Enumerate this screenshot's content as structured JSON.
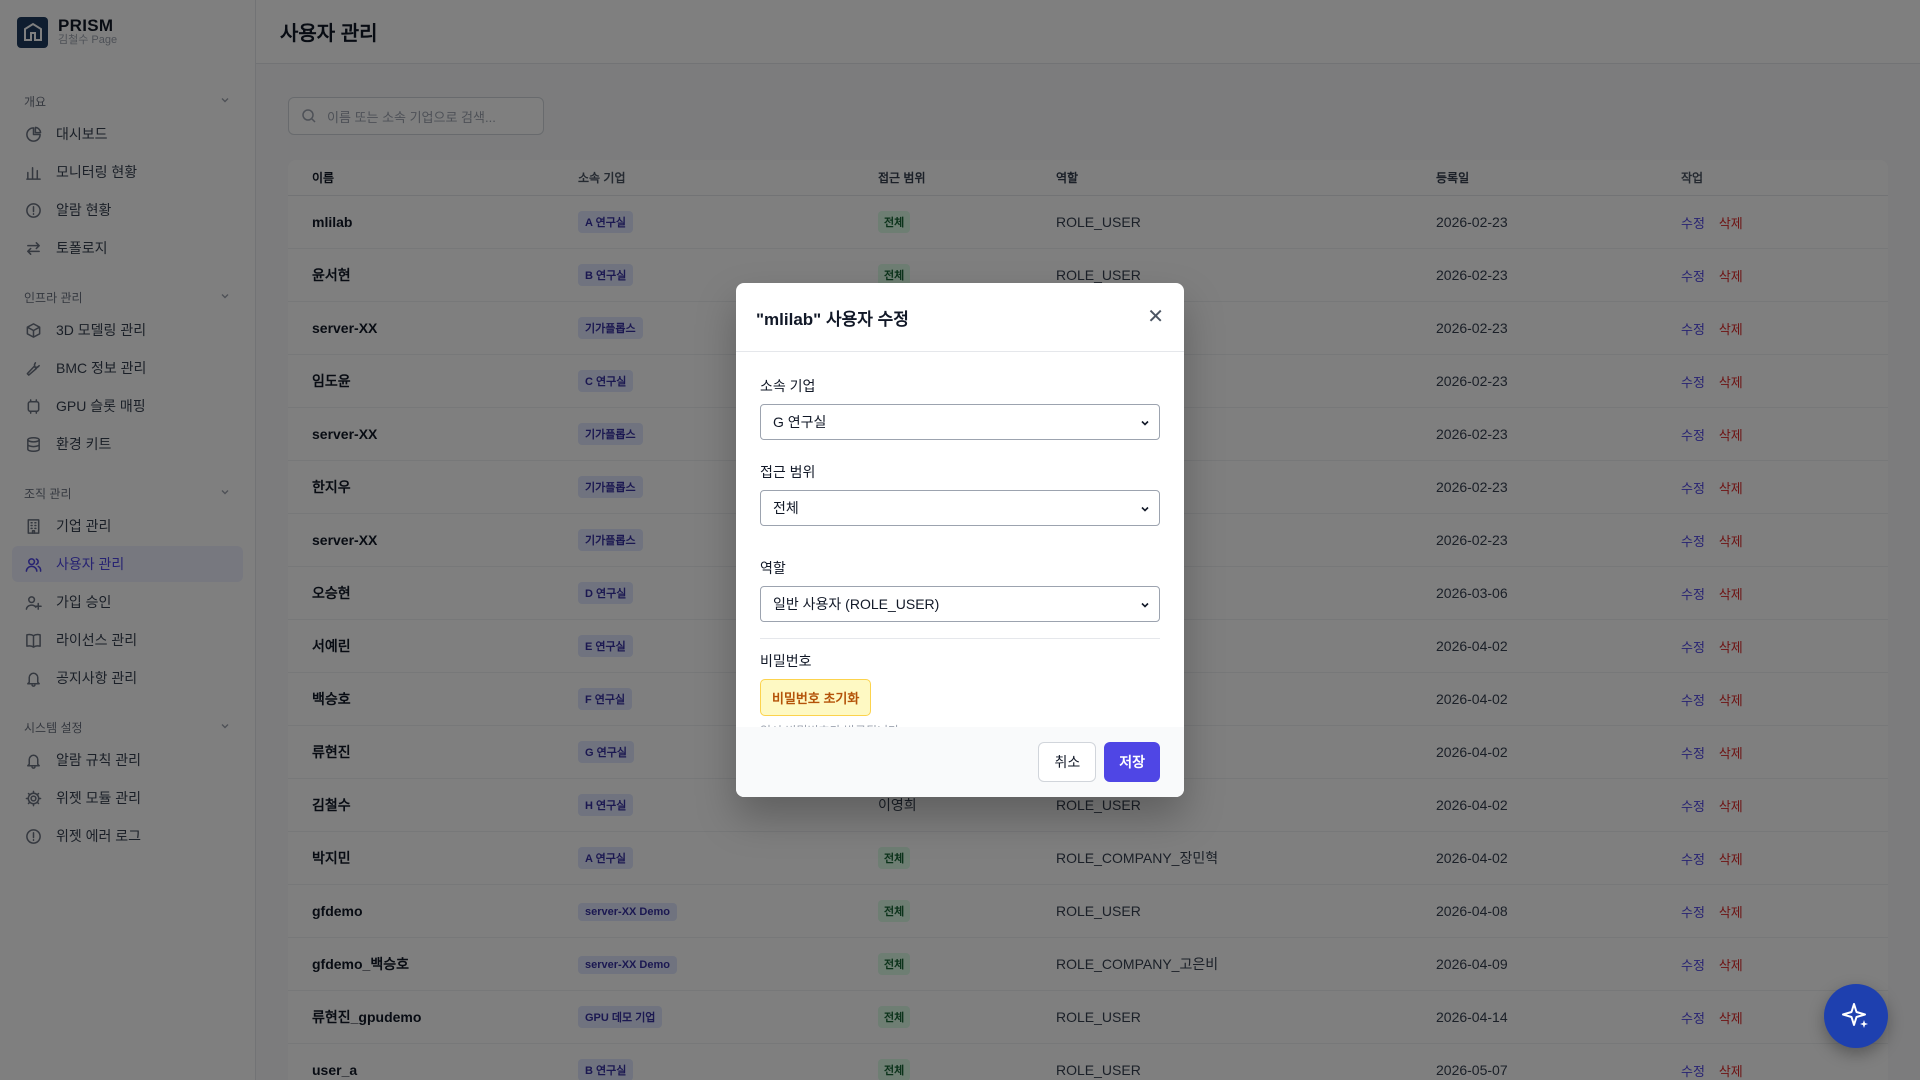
{
  "brand": {
    "name": "PRISM",
    "sub": "김철수 Page"
  },
  "sidebar": {
    "sections": [
      {
        "title": "개요",
        "items": [
          {
            "label": "대시보드",
            "icon": "pie-chart-icon"
          },
          {
            "label": "모니터링 현황",
            "icon": "bar-chart-icon"
          },
          {
            "label": "알람 현황",
            "icon": "alert-circle-icon"
          },
          {
            "label": "토폴로지",
            "icon": "arrows-swap-icon"
          }
        ]
      },
      {
        "title": "인프라 관리",
        "items": [
          {
            "label": "3D 모델링 관리",
            "icon": "cube-icon"
          },
          {
            "label": "BMC 정보 관리",
            "icon": "wrench-icon"
          },
          {
            "label": "GPU 슬롯 매핑",
            "icon": "chip-icon"
          },
          {
            "label": "환경 키트",
            "icon": "database-icon"
          }
        ]
      },
      {
        "title": "조직 관리",
        "items": [
          {
            "label": "기업 관리",
            "icon": "building-icon"
          },
          {
            "label": "사용자 관리",
            "icon": "users-icon",
            "active": true
          },
          {
            "label": "가입 승인",
            "icon": "user-plus-icon"
          },
          {
            "label": "라이선스 관리",
            "icon": "book-icon"
          },
          {
            "label": "공지사항 관리",
            "icon": "bell-icon"
          }
        ]
      },
      {
        "title": "시스템 설정",
        "items": [
          {
            "label": "알람 규칙 관리",
            "icon": "bell-icon"
          },
          {
            "label": "위젯 모듈 관리",
            "icon": "gear-icon"
          },
          {
            "label": "위젯 에러 로그",
            "icon": "alert-circle-icon"
          }
        ]
      }
    ]
  },
  "header": {
    "title": "사용자 관리"
  },
  "search": {
    "placeholder": "이름 또는 소속 기업으로 검색..."
  },
  "table": {
    "columns": [
      "이름",
      "소속 기업",
      "접근 범위",
      "역할",
      "등록일",
      "작업"
    ],
    "edit_label": "수정",
    "delete_label": "삭제",
    "rows": [
      {
        "name": "mlilab",
        "company": "A 연구실",
        "scope": "전체",
        "role": "ROLE_USER",
        "date": "2026-02-23"
      },
      {
        "name": "윤서현",
        "company": "B 연구실",
        "scope": "전체",
        "role": "ROLE_USER",
        "date": "2026-02-23"
      },
      {
        "name": "server-XX",
        "company": "기가플롭스",
        "scope": "",
        "role": "",
        "date": "2026-02-23"
      },
      {
        "name": "임도윤",
        "company": "C 연구실",
        "scope": "",
        "role": "",
        "date": "2026-02-23"
      },
      {
        "name": "server-XX",
        "company": "기가플롭스",
        "scope": "",
        "role": "",
        "date": "2026-02-23"
      },
      {
        "name": "한지우",
        "company": "기가플롭스",
        "scope": "",
        "role": "",
        "date": "2026-02-23"
      },
      {
        "name": "server-XX",
        "company": "기가플롭스",
        "scope": "",
        "role": "",
        "date": "2026-02-23"
      },
      {
        "name": "오승현",
        "company": "D 연구실",
        "scope": "",
        "role": "",
        "date": "2026-03-06"
      },
      {
        "name": "서예린",
        "company": "E 연구실",
        "scope": "",
        "role": "",
        "date": "2026-04-02"
      },
      {
        "name": "백승호",
        "company": "F 연구실",
        "scope": "",
        "role": "",
        "date": "2026-04-02"
      },
      {
        "name": "류현진",
        "company": "G 연구실",
        "scope": "",
        "role": "",
        "date": "2026-04-02"
      },
      {
        "name": "김철수",
        "company": "H 연구실",
        "scope_text": "이영희",
        "role": "ROLE_USER",
        "date": "2026-04-02"
      },
      {
        "name": "박지민",
        "company": "A 연구실",
        "scope": "전체",
        "role": "ROLE_COMPANY_장민혁",
        "date": "2026-04-02"
      },
      {
        "name": "gfdemo",
        "company": "server-XX Demo",
        "scope": "전체",
        "role": "ROLE_USER",
        "date": "2026-04-08"
      },
      {
        "name": "gfdemo_백승호",
        "company": "server-XX Demo",
        "scope": "전체",
        "role": "ROLE_COMPANY_고은비",
        "date": "2026-04-09"
      },
      {
        "name": "류현진_gpudemo",
        "company": "GPU 데모 기업",
        "scope": "전체",
        "role": "ROLE_USER",
        "date": "2026-04-14"
      },
      {
        "name": "user_a",
        "company": "B 연구실",
        "scope": "전체",
        "role": "ROLE_USER",
        "date": "2026-05-07"
      }
    ]
  },
  "modal": {
    "title": "\"mlilab\" 사용자 수정",
    "company_label": "소속 기업",
    "company_value": "G 연구실",
    "scope_label": "접근 범위",
    "scope_value": "전체",
    "role_label": "역할",
    "role_value": "일반 사용자 (ROLE_USER)",
    "password_label": "비밀번호",
    "reset_label": "비밀번호 초기화",
    "reset_hint": "임시 비밀번호가 발급됩니다.",
    "cancel_label": "취소",
    "save_label": "저장"
  },
  "colors": {
    "accent": "#4f46e5",
    "danger": "#dc2626",
    "fab": "#1e40af"
  }
}
